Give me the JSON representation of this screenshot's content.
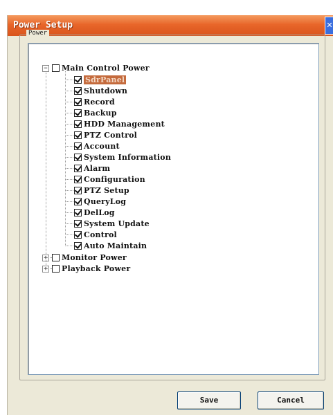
{
  "dialog": {
    "title": "Power Setup",
    "group_label": "Power"
  },
  "tree": {
    "root": {
      "label": "Main Control Power",
      "expander": "−",
      "checked": false
    },
    "children": [
      {
        "label": "SdrPanel",
        "checked": true,
        "selected": true
      },
      {
        "label": "Shutdown",
        "checked": true
      },
      {
        "label": "Record",
        "checked": true
      },
      {
        "label": "Backup",
        "checked": true
      },
      {
        "label": "HDD Management",
        "checked": true
      },
      {
        "label": "PTZ Control",
        "checked": true
      },
      {
        "label": "Account",
        "checked": true
      },
      {
        "label": "System Information",
        "checked": true
      },
      {
        "label": "Alarm",
        "checked": true
      },
      {
        "label": "Configuration",
        "checked": true
      },
      {
        "label": "PTZ Setup",
        "checked": true
      },
      {
        "label": "QueryLog",
        "checked": true
      },
      {
        "label": "DelLog",
        "checked": true
      },
      {
        "label": "System Update",
        "checked": true
      },
      {
        "label": "Control",
        "checked": true
      },
      {
        "label": "Auto Maintain",
        "checked": true
      }
    ],
    "siblings": [
      {
        "label": "Monitor Power",
        "expander": "+",
        "checked": false
      },
      {
        "label": "Playback Power",
        "expander": "+",
        "checked": false
      }
    ]
  },
  "buttons": {
    "save": "Save",
    "cancel": "Cancel"
  },
  "colors": {
    "titlebar": "#e8662a",
    "dialog_bg": "#ece9d8",
    "selection": "#c46a3c"
  }
}
